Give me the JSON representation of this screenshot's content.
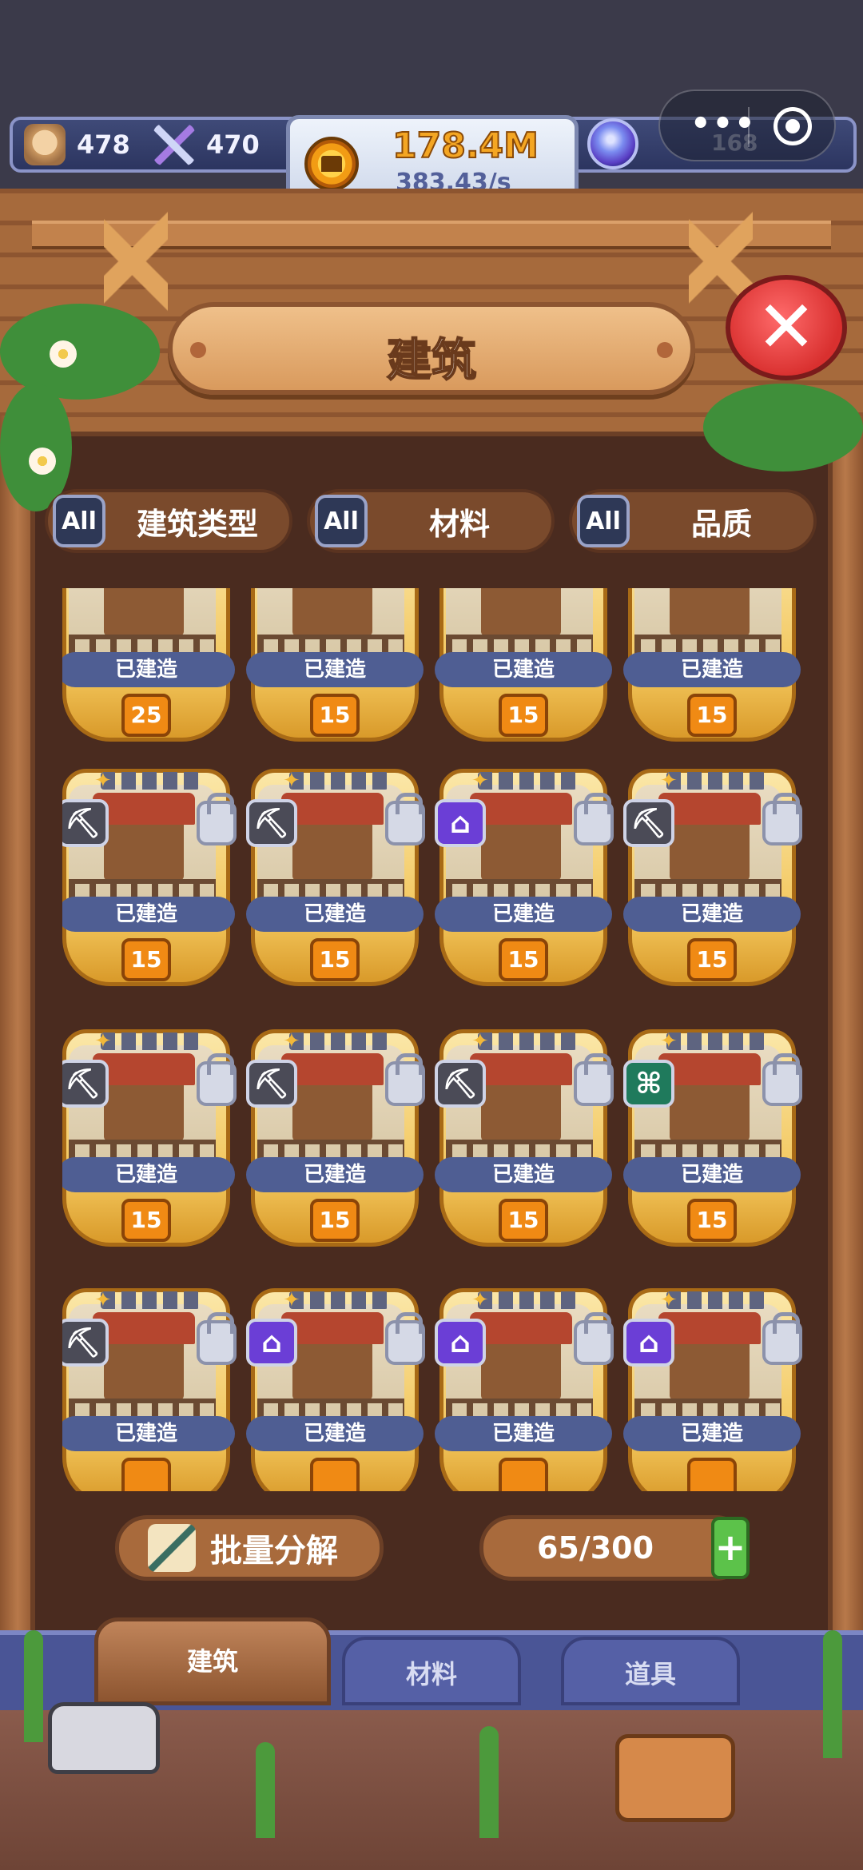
{
  "resources": {
    "population": "478",
    "power": "470",
    "gold_main": "178.4M",
    "gold_rate": "383.43/s",
    "gems": "168"
  },
  "capsule": {
    "more": "•••"
  },
  "title": "建筑",
  "close_glyph": "✕",
  "filters": [
    {
      "all": "All",
      "label": "建筑类型"
    },
    {
      "all": "All",
      "label": "材料"
    },
    {
      "all": "All",
      "label": "品质"
    }
  ],
  "cards": [
    {
      "status": "已建造",
      "level": "25",
      "type": "",
      "locked": false,
      "stars": false
    },
    {
      "status": "已建造",
      "level": "15",
      "type": "",
      "locked": false,
      "stars": false
    },
    {
      "status": "已建造",
      "level": "15",
      "type": "",
      "locked": false,
      "stars": false
    },
    {
      "status": "已建造",
      "level": "15",
      "type": "",
      "locked": false,
      "stars": false
    },
    {
      "status": "已建造",
      "level": "15",
      "type": "pickaxe-icon",
      "locked": true,
      "stars": true
    },
    {
      "status": "已建造",
      "level": "15",
      "type": "pickaxe-icon",
      "locked": true,
      "stars": true
    },
    {
      "status": "已建造",
      "level": "15",
      "type": "house-icon",
      "locked": true,
      "stars": true
    },
    {
      "status": "已建造",
      "level": "15",
      "type": "pickaxe-icon",
      "locked": true,
      "stars": true
    },
    {
      "status": "已建造",
      "level": "15",
      "type": "pickaxe-icon",
      "locked": true,
      "stars": true
    },
    {
      "status": "已建造",
      "level": "15",
      "type": "pickaxe-icon",
      "locked": true,
      "stars": true
    },
    {
      "status": "已建造",
      "level": "15",
      "type": "pickaxe-icon",
      "locked": true,
      "stars": true
    },
    {
      "status": "已建造",
      "level": "15",
      "type": "temple-icon",
      "locked": true,
      "stars": true
    },
    {
      "status": "已建造",
      "level": "",
      "type": "pickaxe-icon",
      "locked": true,
      "stars": true
    },
    {
      "status": "已建造",
      "level": "",
      "type": "house-icon",
      "locked": true,
      "stars": true
    },
    {
      "status": "已建造",
      "level": "",
      "type": "house-icon",
      "locked": true,
      "stars": true
    },
    {
      "status": "已建造",
      "level": "",
      "type": "house-icon",
      "locked": true,
      "stars": true
    }
  ],
  "actions": {
    "bulk_decompose": "批量分解",
    "capacity": "65/300",
    "plus": "+"
  },
  "tabs": [
    "建筑",
    "材料",
    "道具"
  ],
  "colors": {
    "wood": "#a66a3c",
    "card_gold": "#f2c55a",
    "banner_blue": "#4f5e93",
    "level_orange": "#f08a14",
    "close_red": "#d9302f"
  }
}
